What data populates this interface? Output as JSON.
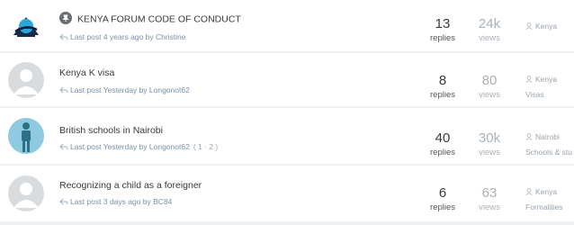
{
  "threads": [
    {
      "title": "KENYA FORUM CODE OF CONDUCT",
      "last_post": "Last post 4 years ago by Christine",
      "pages": "",
      "replies": "13",
      "replies_label": "replies",
      "views": "24k",
      "views_label": "views",
      "forum": "Kenya",
      "subforum": "",
      "avatar": "forum-logo",
      "pinned": true
    },
    {
      "title": "Kenya K visa",
      "last_post": "Last post Yesterday by Longonot62",
      "pages": "",
      "replies": "8",
      "replies_label": "replies",
      "views": "80",
      "views_label": "views",
      "forum": "Kenya",
      "subforum": "Visas",
      "avatar": "default-user",
      "pinned": false
    },
    {
      "title": "British schools in Nairobi",
      "last_post": "Last post Yesterday by Longonot62",
      "pages": "( 1 · 2 )",
      "replies": "40",
      "replies_label": "replies",
      "views": "30k",
      "views_label": "views",
      "forum": "Nairobi",
      "subforum": "Schools & stu",
      "avatar": "person-figure",
      "pinned": false
    },
    {
      "title": "Recognizing a child as a foreigner",
      "last_post": "Last post 3 days ago by BC84",
      "pages": "",
      "replies": "6",
      "replies_label": "replies",
      "views": "63",
      "views_label": "views",
      "forum": "Kenya",
      "subforum": "Formalities",
      "avatar": "default-user",
      "pinned": false
    }
  ]
}
